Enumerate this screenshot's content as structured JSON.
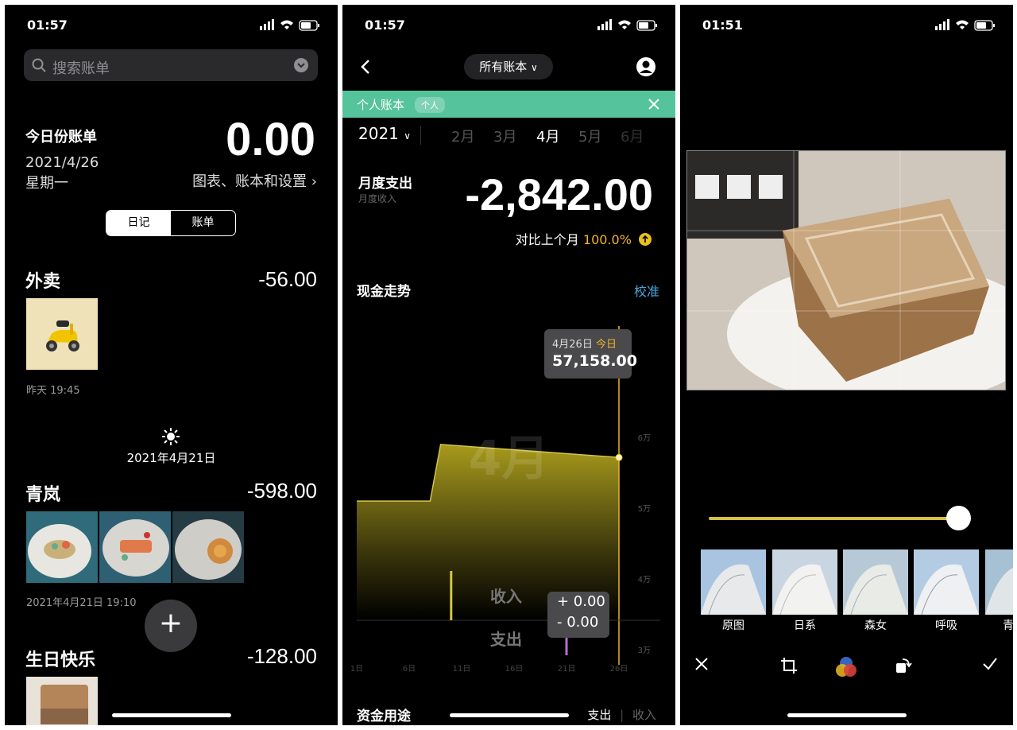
{
  "phone1": {
    "status_time": "01:57",
    "search_placeholder": "搜索账单",
    "today_label": "今日份账单",
    "today_amount": "0.00",
    "date": "2021/4/26",
    "weekday": "星期一",
    "settings_link": "图表、账本和设置",
    "tabs": [
      "日记",
      "账单"
    ],
    "entries": [
      {
        "title": "外卖",
        "amount": "-56.00",
        "time": "昨天 19:45"
      },
      {
        "title": "青岚",
        "amount": "-598.00",
        "time": "2021年4月21日 19:10"
      },
      {
        "title": "生日快乐",
        "amount": "-128.00"
      }
    ],
    "day_header": "2021年4月21日",
    "fab_label": "+"
  },
  "phone2": {
    "status_time": "01:57",
    "book_selector": "所有账本",
    "banner_title": "个人账本",
    "banner_tag": "个人",
    "year": "2021",
    "months": [
      "2月",
      "3月",
      "4月",
      "5月",
      "6月"
    ],
    "active_month": "4月",
    "monthly_label": "月度支出",
    "monthly_sub": "月度收入",
    "monthly_amount": "-2,842.00",
    "compare_label": "对比上个月",
    "compare_pct": "100.0%",
    "trend_title": "现金走势",
    "calibrate": "校准",
    "tooltip_date": "4月26日",
    "tooltip_today": "今日",
    "tooltip_value": "57,158.00",
    "income_label": "收入",
    "expense_label": "支出",
    "income_value": "+ 0.00",
    "expense_value": "- 0.00",
    "watermark": "4月",
    "usage_title": "资金用途",
    "usage_tabs": [
      "支出",
      "收入"
    ],
    "accent": "#f0b429",
    "banner_color": "#55c39c"
  },
  "chart_data": {
    "type": "area",
    "title": "现金走势",
    "x_ticks": [
      "1日",
      "6日",
      "11日",
      "16日",
      "21日",
      "26日"
    ],
    "y_ticks": [
      "6万",
      "5万",
      "4万",
      "3万"
    ],
    "x": [
      1,
      8,
      9,
      26
    ],
    "values": [
      51000,
      51000,
      59000,
      57158
    ],
    "highlight": {
      "x": "4月26日",
      "value": 57158.0
    }
  },
  "phone3": {
    "status_time": "01:51",
    "slider_value": 0.95,
    "filters": [
      "原图",
      "日系",
      "森女",
      "呼吸",
      "青"
    ],
    "tools": [
      "close-icon",
      "crop-icon",
      "color-filter-icon",
      "rotate-icon",
      "check-icon"
    ]
  }
}
